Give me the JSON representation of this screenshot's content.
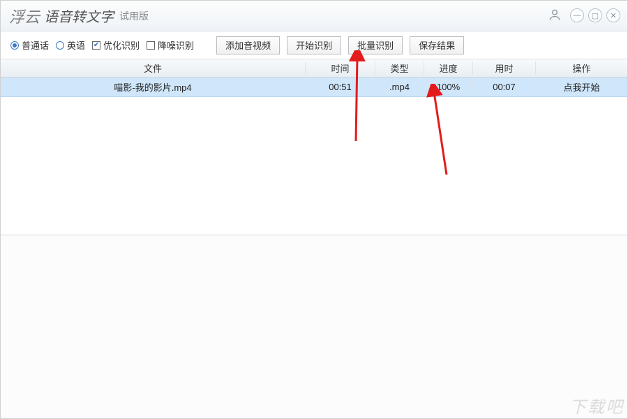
{
  "header": {
    "brand": "浮云",
    "title": "语音转文字",
    "edition": "试用版"
  },
  "toolbar": {
    "radio_mandarin": "普通话",
    "radio_english": "英语",
    "check_optimize": "优化识别",
    "check_denoise": "降噪识别",
    "btn_add": "添加音视频",
    "btn_start": "开始识别",
    "btn_batch": "批量识别",
    "btn_save": "保存结果"
  },
  "columns": {
    "file": "文件",
    "time": "时间",
    "type": "类型",
    "progress": "进度",
    "used": "用时",
    "op": "操作"
  },
  "rows": [
    {
      "file": "喵影-我的影片.mp4",
      "time": "00:51",
      "type": ".mp4",
      "progress": "100%",
      "used": "00:07",
      "op": "点我开始"
    }
  ],
  "watermark": "下载吧"
}
